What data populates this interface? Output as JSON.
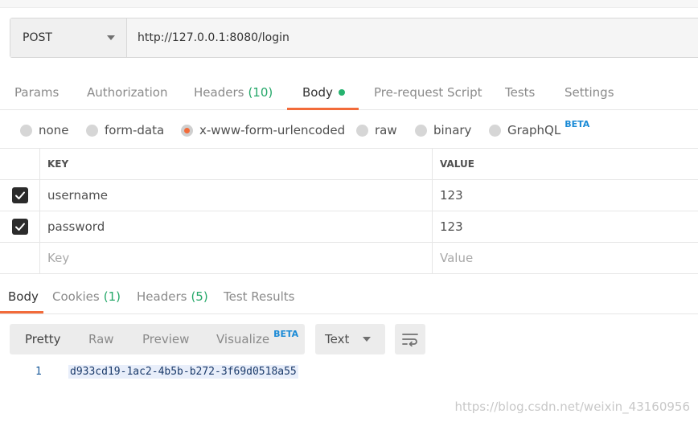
{
  "request": {
    "method": "POST",
    "url": "http://127.0.0.1:8080/login"
  },
  "req_tabs": [
    {
      "label": "Params"
    },
    {
      "label": "Authorization"
    },
    {
      "label": "Headers",
      "count": "(10)"
    },
    {
      "label": "Body"
    },
    {
      "label": "Pre-request Script"
    },
    {
      "label": "Tests"
    },
    {
      "label": "Settings"
    }
  ],
  "body_types": [
    {
      "label": "none"
    },
    {
      "label": "form-data"
    },
    {
      "label": "x-www-form-urlencoded"
    },
    {
      "label": "raw"
    },
    {
      "label": "binary"
    },
    {
      "label": "GraphQL",
      "badge": "BETA"
    }
  ],
  "kv_table": {
    "headers": {
      "key": "KEY",
      "value": "VALUE"
    },
    "rows": [
      {
        "key": "username",
        "value": "123"
      },
      {
        "key": "password",
        "value": "123"
      }
    ],
    "placeholder": {
      "key": "Key",
      "value": "Value"
    }
  },
  "res_tabs": [
    {
      "label": "Body"
    },
    {
      "label": "Cookies",
      "count": "(1)"
    },
    {
      "label": "Headers",
      "count": "(5)"
    },
    {
      "label": "Test Results"
    }
  ],
  "view_modes": [
    {
      "label": "Pretty"
    },
    {
      "label": "Raw"
    },
    {
      "label": "Preview"
    },
    {
      "label": "Visualize",
      "badge": "BETA"
    }
  ],
  "format": "Text",
  "response_lines": [
    {
      "no": "1",
      "text": "d933cd19-1ac2-4b5b-b272-3f69d0518a55"
    }
  ],
  "watermark": "https://blog.csdn.net/weixin_43160956",
  "colors": {
    "accent": "#f26b3a",
    "count_green": "#26a86a",
    "beta_blue": "#1a8ad6"
  },
  "icons": {
    "method_caret": "chevron-down-icon",
    "format_caret": "chevron-down-icon",
    "wrap": "wrap-lines-icon",
    "check": "check-icon"
  }
}
